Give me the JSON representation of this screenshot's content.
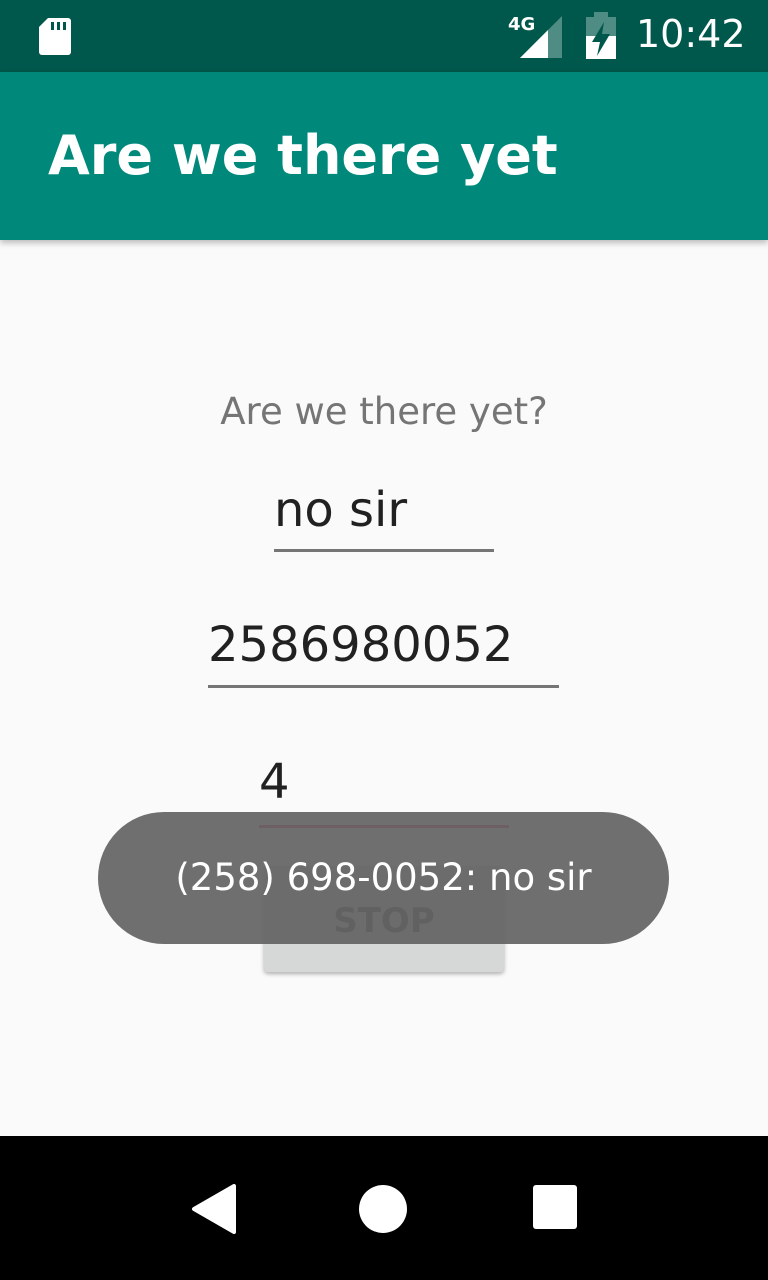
{
  "status_bar": {
    "network_type": "4G",
    "time": "10:42",
    "icons": [
      "sd-card-icon",
      "signal-icon",
      "battery-charging-icon"
    ]
  },
  "app_bar": {
    "title": "Are we there yet"
  },
  "main": {
    "question": "Are we there yet?",
    "reply_value": "no sir",
    "phone_value": "2586980052",
    "count_value": "4",
    "stop_button_label": "STOP"
  },
  "toast": {
    "message": "(258) 698-0052: no sir"
  },
  "nav_bar": {
    "icons": [
      "back-icon",
      "home-icon",
      "recents-icon"
    ]
  },
  "colors": {
    "status_bar": "#00574b",
    "app_bar": "#00897b",
    "accent": "#d81b60"
  }
}
